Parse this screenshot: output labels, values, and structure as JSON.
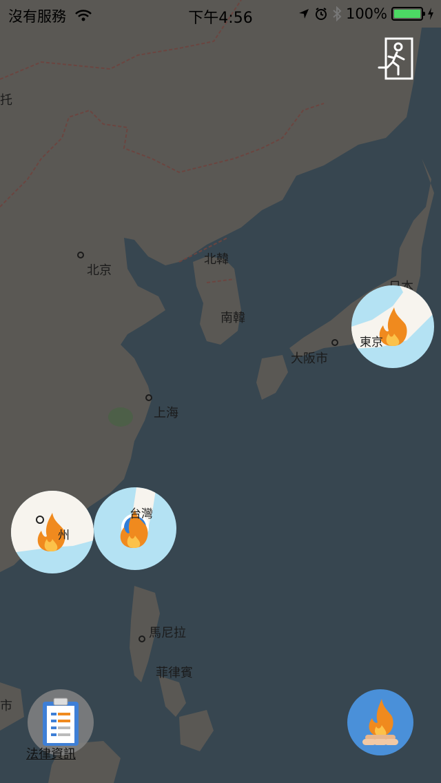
{
  "status_bar": {
    "carrier": "沒有服務",
    "time": "下午4:56",
    "battery": "100%",
    "icons": [
      "wifi-icon",
      "location-arrow-icon",
      "alarm-icon",
      "bluetooth-icon",
      "battery-icon",
      "charging-icon"
    ]
  },
  "map": {
    "labels": {
      "tuo": "托",
      "beijing": "北京",
      "north_korea": "北韓",
      "south_korea": "南韓",
      "japan": "日本",
      "osaka": "大阪市",
      "shanghai": "上海",
      "manila": "馬尼拉",
      "philippines": "菲律賓",
      "shi": "市"
    }
  },
  "markers": {
    "tokyo": {
      "label": "東京",
      "icon": "fire-icon"
    },
    "fuzhou": {
      "label": "州",
      "icon": "fire-icon"
    },
    "taiwan": {
      "label": "台灣",
      "icon": "fire-icon"
    }
  },
  "controls": {
    "exit_icon": "exit-icon",
    "clipboard_icon": "clipboard-icon",
    "bottom_left_label": "法律資訊",
    "campfire_icon": "campfire-icon"
  },
  "colors": {
    "land": "#5a5854",
    "water": "#374650",
    "marker_water": "#b4e2f3",
    "marker_land": "#f7f4ee",
    "flame": "#f08a1e",
    "battery_green": "#4cd964",
    "campfire_bg": "#4a90d9"
  }
}
